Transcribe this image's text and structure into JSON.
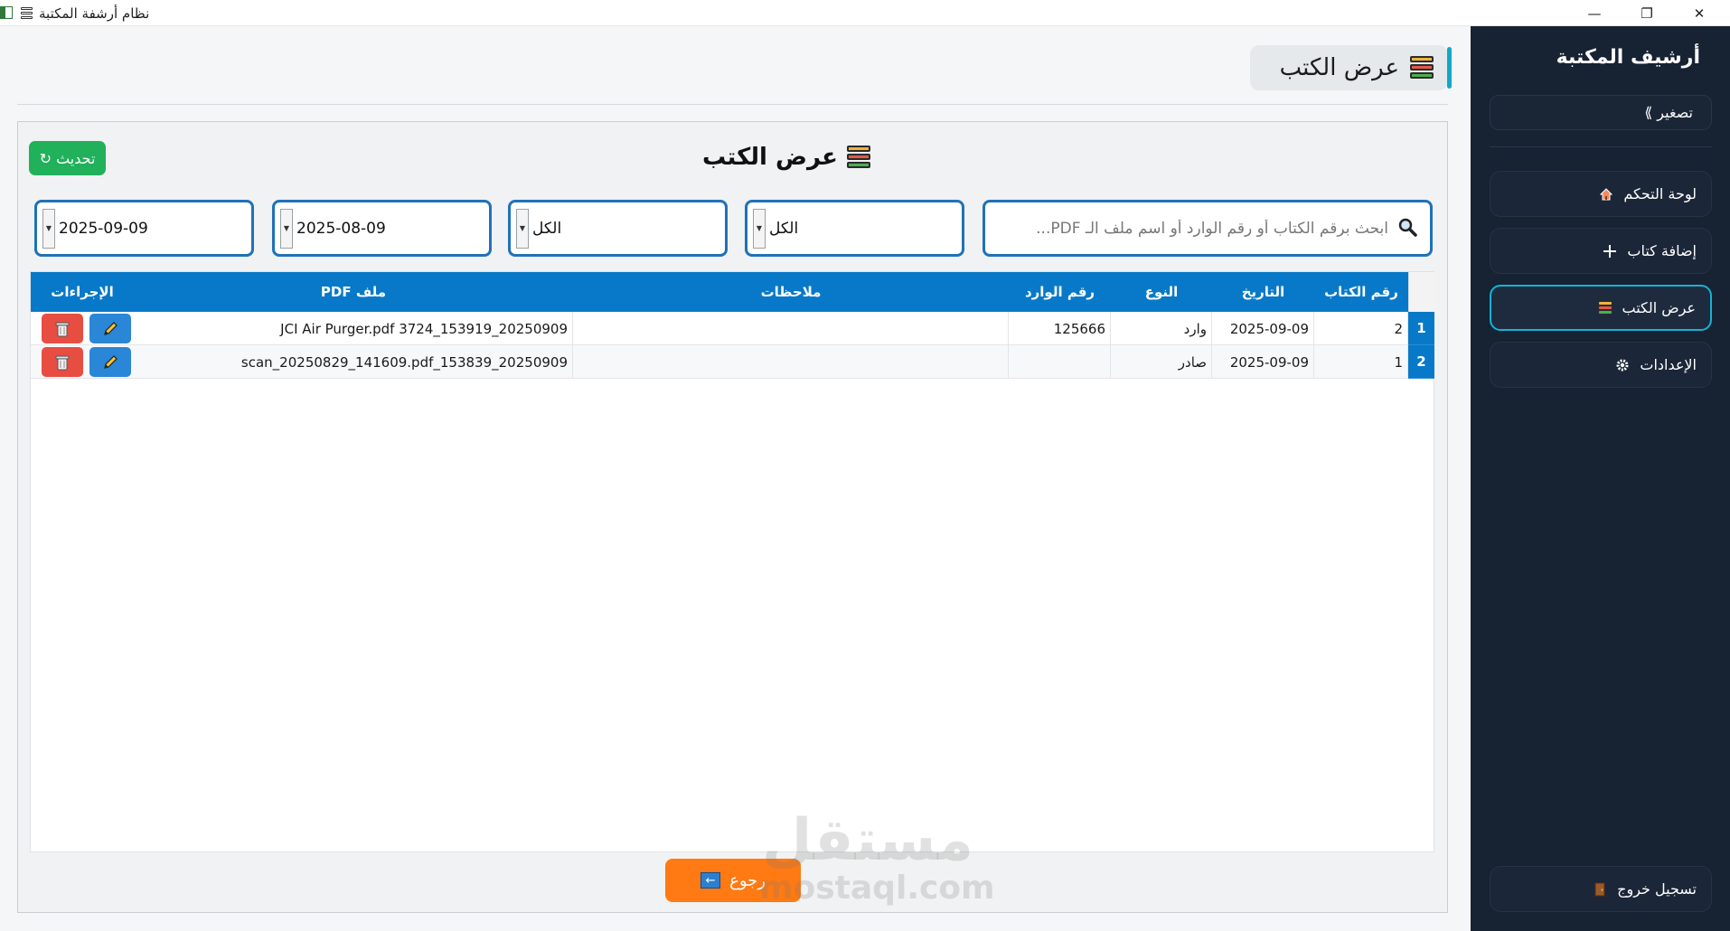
{
  "window": {
    "title": "نظام أرشفة المكتبة",
    "controls": {
      "minimize": "—",
      "restore": "❐",
      "close": "✕"
    }
  },
  "sidebar": {
    "title": "أرشيف المكتبة",
    "collapse_label": "تصغير ⟫",
    "items": [
      {
        "label": "لوحة التحكم",
        "icon": "home-icon"
      },
      {
        "label": "إضافة كتاب",
        "icon": "plus-icon"
      },
      {
        "label": "عرض الكتب",
        "icon": "books-icon",
        "active": true
      },
      {
        "label": "الإعدادات",
        "icon": "gear-icon"
      }
    ],
    "logout_label": "تسجيل خروج",
    "logout_icon": "door-icon"
  },
  "page": {
    "heading": "عرض الكتب",
    "card_title": "عرض الكتب",
    "refresh_label": "تحديث ↻"
  },
  "filters": {
    "search_placeholder": "ابحث برقم الكتاب أو رقم الوارد أو اسم ملف الـ PDF...",
    "type_value": "الكل",
    "status_value": "الكل",
    "date_from": "2025-08-09",
    "date_to": "2025-09-09"
  },
  "table": {
    "columns": [
      "رقم الكتاب",
      "التاريخ",
      "النوع",
      "رقم الوارد",
      "ملاحظات",
      "PDF ملف",
      "الإجراءات"
    ],
    "rows": [
      {
        "row_header": "1",
        "book_no": "2",
        "date": "2025-09-09",
        "type": "وارد",
        "incoming_no": "125666",
        "notes": "",
        "pdf": "JCI Air Purger.pdf 3724_153919_20250909"
      },
      {
        "row_header": "2",
        "book_no": "1",
        "date": "2025-09-09",
        "type": "صادر",
        "incoming_no": "",
        "notes": "",
        "pdf": "scan_20250829_141609.pdf_153839_20250909"
      }
    ]
  },
  "back_label": "رجوع",
  "watermark": {
    "ar": "مستقل",
    "en": "mostaql.com"
  },
  "colors": {
    "sidebar_bg": "#172233",
    "active_accent": "#13b4d6",
    "table_header": "#0879c9",
    "refresh_green": "#20b15a",
    "back_orange": "#ff7a12",
    "delete_red": "#e84d42",
    "edit_blue": "#2a86d6"
  }
}
